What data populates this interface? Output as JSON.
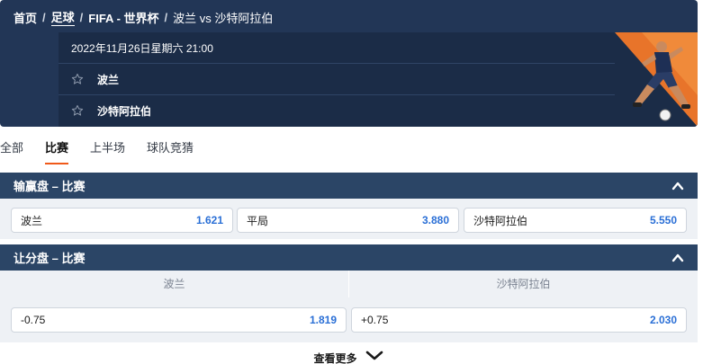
{
  "breadcrumb": {
    "home": "首页",
    "football": "足球",
    "competition": "FIFA - 世界杯",
    "match": "波兰 vs 沙特阿拉伯",
    "separator": "/"
  },
  "match": {
    "datetime": "2022年11月26日星期六 21:00",
    "team_home": "波兰",
    "team_away": "沙特阿拉伯",
    "star_icon": "star-icon"
  },
  "tabs": [
    {
      "label": "全部",
      "active": false
    },
    {
      "label": "比赛",
      "active": true
    },
    {
      "label": "上半场",
      "active": false
    },
    {
      "label": "球队竞猜",
      "active": false
    }
  ],
  "market_1x2": {
    "title": "输赢盘 – 比赛",
    "options": [
      {
        "label": "波兰",
        "price": "1.621"
      },
      {
        "label": "平局",
        "price": "3.880"
      },
      {
        "label": "沙特阿拉伯",
        "price": "5.550"
      }
    ]
  },
  "market_handicap": {
    "title": "让分盘 – 比赛",
    "columns": [
      "波兰",
      "沙特阿拉伯"
    ],
    "options": [
      {
        "label": "-0.75",
        "price": "1.819"
      },
      {
        "label": "+0.75",
        "price": "2.030"
      }
    ]
  },
  "more": {
    "label": "查看更多"
  },
  "colors": {
    "header_bg": "#223656",
    "section_bar": "#2b4566",
    "price_blue": "#2a6fd6",
    "tab_accent": "#f05a1a"
  }
}
